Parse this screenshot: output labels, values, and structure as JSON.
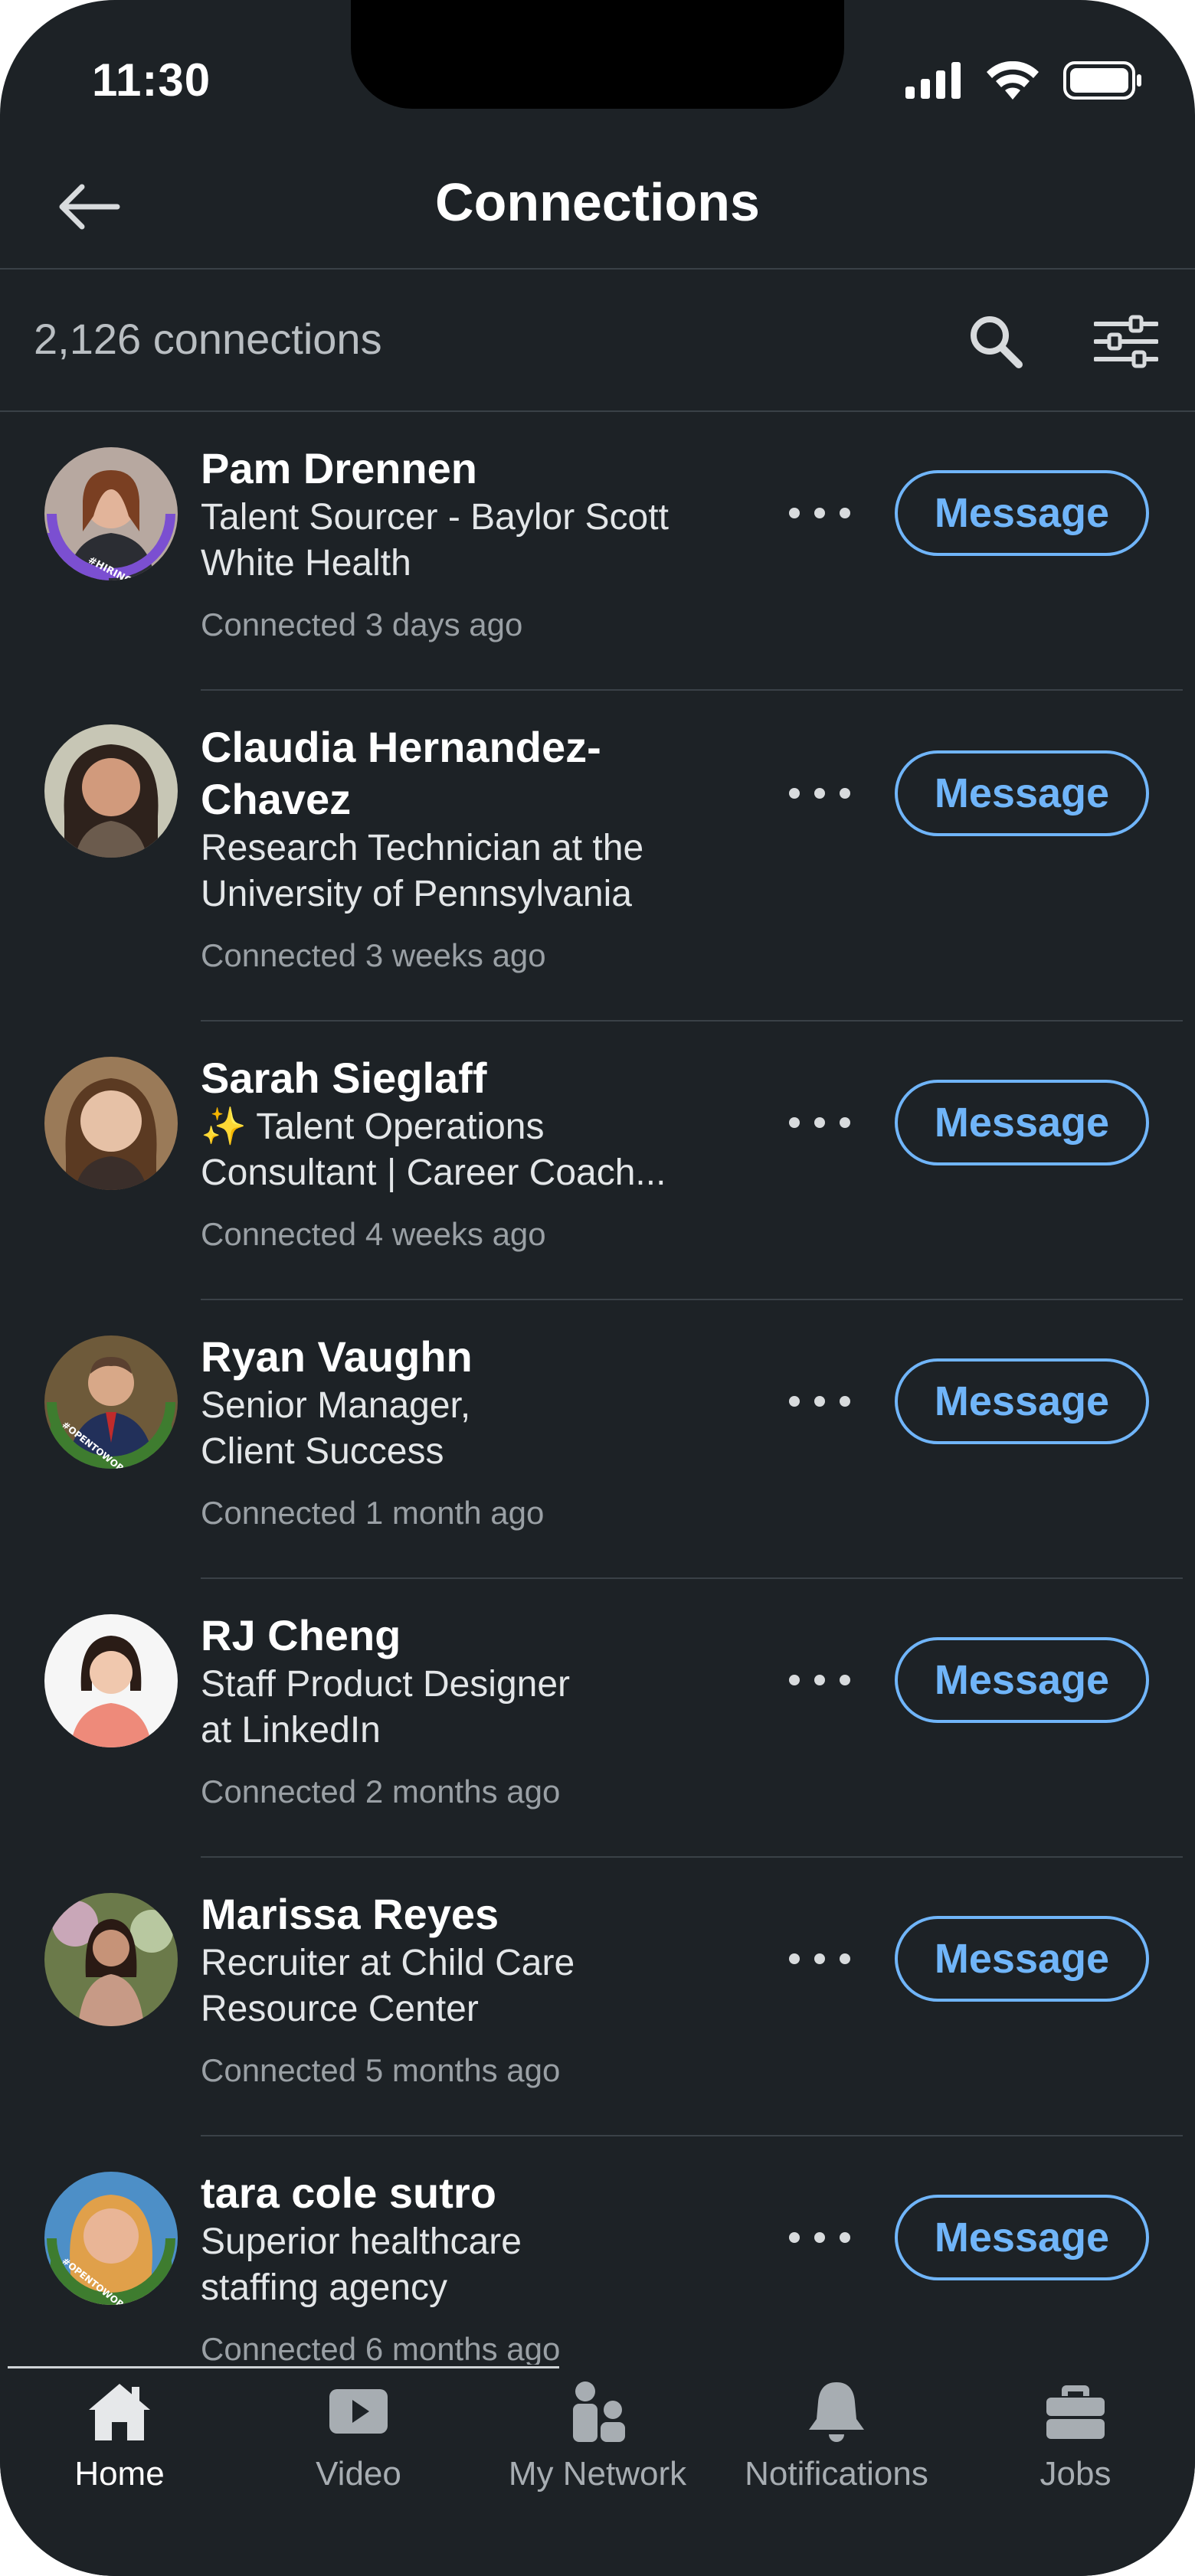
{
  "status_bar": {
    "time": "11:30"
  },
  "header": {
    "title": "Connections"
  },
  "toolbar": {
    "count_text": "2,126 connections"
  },
  "colors": {
    "background": "#1d2226",
    "accent": "#70b5f9",
    "text": "#ffffff",
    "muted": "#9aa0a5"
  },
  "connections": [
    {
      "name": "Pam Drennen",
      "headline": [
        "Talent Sourcer - Baylor Scott",
        "White Health"
      ],
      "connected": "Connected 3 days ago",
      "badge": "#HIRING",
      "button": "Message"
    },
    {
      "name": "Claudia Hernandez-Chavez",
      "name_lines": [
        "Claudia Hernandez-",
        "Chavez"
      ],
      "headline": [
        "Research Technician at the",
        "University of Pennsylvania"
      ],
      "connected": "Connected 3 weeks ago",
      "button": "Message"
    },
    {
      "name": "Sarah Sieglaff",
      "headline": [
        "✨ Talent Operations",
        "Consultant | Career Coach..."
      ],
      "connected": "Connected 4 weeks ago",
      "button": "Message"
    },
    {
      "name": "Ryan Vaughn",
      "headline": [
        "Senior Manager,",
        "Client Success"
      ],
      "connected": "Connected 1 month ago",
      "badge": "#OPENTOWORK",
      "button": "Message"
    },
    {
      "name": "RJ Cheng",
      "headline": [
        "Staff Product Designer",
        "at LinkedIn"
      ],
      "connected": "Connected 2 months ago",
      "button": "Message"
    },
    {
      "name": "Marissa Reyes",
      "headline": [
        "Recruiter at Child Care",
        "Resource Center"
      ],
      "connected": "Connected 5 months ago",
      "button": "Message"
    },
    {
      "name": "tara cole sutro",
      "headline": [
        "Superior healthcare",
        "staffing agency"
      ],
      "connected": "Connected 6 months ago",
      "badge": "#OPENTOWORK",
      "button": "Message"
    }
  ],
  "tabs": [
    {
      "label": "Home",
      "icon": "home-icon",
      "active": true
    },
    {
      "label": "Video",
      "icon": "video-icon"
    },
    {
      "label": "My Network",
      "icon": "my-network-icon"
    },
    {
      "label": "Notifications",
      "icon": "bell-icon"
    },
    {
      "label": "Jobs",
      "icon": "briefcase-icon"
    }
  ]
}
